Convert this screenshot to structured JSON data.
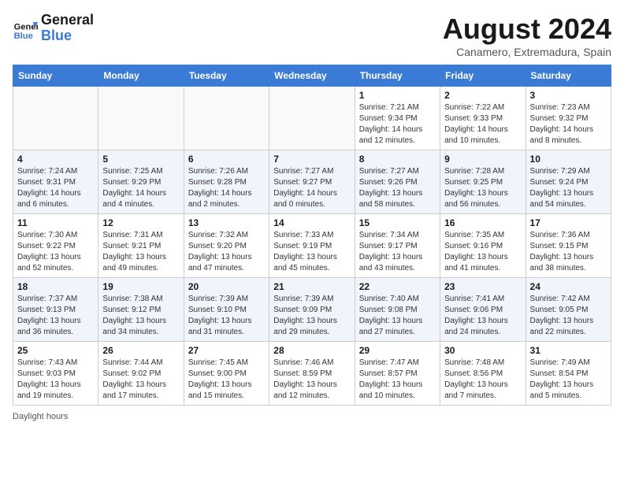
{
  "header": {
    "logo_line1": "General",
    "logo_line2": "Blue",
    "main_title": "August 2024",
    "subtitle": "Canamero, Extremadura, Spain"
  },
  "days_of_week": [
    "Sunday",
    "Monday",
    "Tuesday",
    "Wednesday",
    "Thursday",
    "Friday",
    "Saturday"
  ],
  "weeks": [
    [
      {
        "day": "",
        "info": ""
      },
      {
        "day": "",
        "info": ""
      },
      {
        "day": "",
        "info": ""
      },
      {
        "day": "",
        "info": ""
      },
      {
        "day": "1",
        "info": "Sunrise: 7:21 AM\nSunset: 9:34 PM\nDaylight: 14 hours and 12 minutes."
      },
      {
        "day": "2",
        "info": "Sunrise: 7:22 AM\nSunset: 9:33 PM\nDaylight: 14 hours and 10 minutes."
      },
      {
        "day": "3",
        "info": "Sunrise: 7:23 AM\nSunset: 9:32 PM\nDaylight: 14 hours and 8 minutes."
      }
    ],
    [
      {
        "day": "4",
        "info": "Sunrise: 7:24 AM\nSunset: 9:31 PM\nDaylight: 14 hours and 6 minutes."
      },
      {
        "day": "5",
        "info": "Sunrise: 7:25 AM\nSunset: 9:29 PM\nDaylight: 14 hours and 4 minutes."
      },
      {
        "day": "6",
        "info": "Sunrise: 7:26 AM\nSunset: 9:28 PM\nDaylight: 14 hours and 2 minutes."
      },
      {
        "day": "7",
        "info": "Sunrise: 7:27 AM\nSunset: 9:27 PM\nDaylight: 14 hours and 0 minutes."
      },
      {
        "day": "8",
        "info": "Sunrise: 7:27 AM\nSunset: 9:26 PM\nDaylight: 13 hours and 58 minutes."
      },
      {
        "day": "9",
        "info": "Sunrise: 7:28 AM\nSunset: 9:25 PM\nDaylight: 13 hours and 56 minutes."
      },
      {
        "day": "10",
        "info": "Sunrise: 7:29 AM\nSunset: 9:24 PM\nDaylight: 13 hours and 54 minutes."
      }
    ],
    [
      {
        "day": "11",
        "info": "Sunrise: 7:30 AM\nSunset: 9:22 PM\nDaylight: 13 hours and 52 minutes."
      },
      {
        "day": "12",
        "info": "Sunrise: 7:31 AM\nSunset: 9:21 PM\nDaylight: 13 hours and 49 minutes."
      },
      {
        "day": "13",
        "info": "Sunrise: 7:32 AM\nSunset: 9:20 PM\nDaylight: 13 hours and 47 minutes."
      },
      {
        "day": "14",
        "info": "Sunrise: 7:33 AM\nSunset: 9:19 PM\nDaylight: 13 hours and 45 minutes."
      },
      {
        "day": "15",
        "info": "Sunrise: 7:34 AM\nSunset: 9:17 PM\nDaylight: 13 hours and 43 minutes."
      },
      {
        "day": "16",
        "info": "Sunrise: 7:35 AM\nSunset: 9:16 PM\nDaylight: 13 hours and 41 minutes."
      },
      {
        "day": "17",
        "info": "Sunrise: 7:36 AM\nSunset: 9:15 PM\nDaylight: 13 hours and 38 minutes."
      }
    ],
    [
      {
        "day": "18",
        "info": "Sunrise: 7:37 AM\nSunset: 9:13 PM\nDaylight: 13 hours and 36 minutes."
      },
      {
        "day": "19",
        "info": "Sunrise: 7:38 AM\nSunset: 9:12 PM\nDaylight: 13 hours and 34 minutes."
      },
      {
        "day": "20",
        "info": "Sunrise: 7:39 AM\nSunset: 9:10 PM\nDaylight: 13 hours and 31 minutes."
      },
      {
        "day": "21",
        "info": "Sunrise: 7:39 AM\nSunset: 9:09 PM\nDaylight: 13 hours and 29 minutes."
      },
      {
        "day": "22",
        "info": "Sunrise: 7:40 AM\nSunset: 9:08 PM\nDaylight: 13 hours and 27 minutes."
      },
      {
        "day": "23",
        "info": "Sunrise: 7:41 AM\nSunset: 9:06 PM\nDaylight: 13 hours and 24 minutes."
      },
      {
        "day": "24",
        "info": "Sunrise: 7:42 AM\nSunset: 9:05 PM\nDaylight: 13 hours and 22 minutes."
      }
    ],
    [
      {
        "day": "25",
        "info": "Sunrise: 7:43 AM\nSunset: 9:03 PM\nDaylight: 13 hours and 19 minutes."
      },
      {
        "day": "26",
        "info": "Sunrise: 7:44 AM\nSunset: 9:02 PM\nDaylight: 13 hours and 17 minutes."
      },
      {
        "day": "27",
        "info": "Sunrise: 7:45 AM\nSunset: 9:00 PM\nDaylight: 13 hours and 15 minutes."
      },
      {
        "day": "28",
        "info": "Sunrise: 7:46 AM\nSunset: 8:59 PM\nDaylight: 13 hours and 12 minutes."
      },
      {
        "day": "29",
        "info": "Sunrise: 7:47 AM\nSunset: 8:57 PM\nDaylight: 13 hours and 10 minutes."
      },
      {
        "day": "30",
        "info": "Sunrise: 7:48 AM\nSunset: 8:56 PM\nDaylight: 13 hours and 7 minutes."
      },
      {
        "day": "31",
        "info": "Sunrise: 7:49 AM\nSunset: 8:54 PM\nDaylight: 13 hours and 5 minutes."
      }
    ]
  ],
  "footer": "Daylight hours"
}
